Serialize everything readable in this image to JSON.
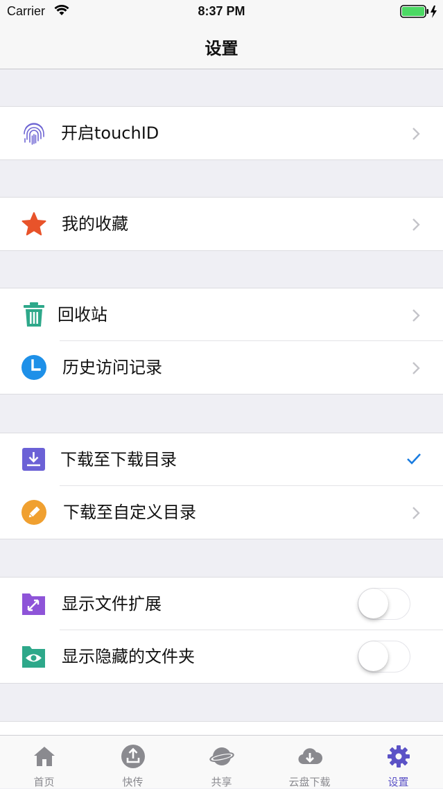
{
  "status_bar": {
    "carrier": "Carrier",
    "time": "8:37 PM",
    "battery_color": "#4cd964"
  },
  "nav": {
    "title": "设置"
  },
  "groups": [
    {
      "rows": [
        {
          "label": "开启touchID",
          "icon": "fingerprint-icon",
          "accessory": "chevron"
        }
      ]
    },
    {
      "rows": [
        {
          "label": "我的收藏",
          "icon": "star-icon",
          "accessory": "chevron"
        }
      ]
    },
    {
      "rows": [
        {
          "label": "回收站",
          "icon": "trash-icon",
          "accessory": "chevron"
        },
        {
          "label": "历史访问记录",
          "icon": "clock-icon",
          "accessory": "chevron"
        }
      ]
    },
    {
      "rows": [
        {
          "label": "下载至下载目录",
          "icon": "download-icon",
          "accessory": "checkmark",
          "selected": true
        },
        {
          "label": "下载至自定义目录",
          "icon": "pencil-icon",
          "accessory": "chevron"
        }
      ]
    },
    {
      "rows": [
        {
          "label": "显示文件扩展",
          "icon": "folder-expand-icon",
          "accessory": "toggle",
          "on": false
        },
        {
          "label": "显示隐藏的文件夹",
          "icon": "folder-eye-icon",
          "accessory": "toggle",
          "on": false
        }
      ]
    }
  ],
  "tabbar": {
    "active_color": "#5b52c6",
    "items": [
      {
        "label": "首页",
        "icon": "home-icon"
      },
      {
        "label": "快传",
        "icon": "upload-icon"
      },
      {
        "label": "共享",
        "icon": "planet-icon"
      },
      {
        "label": "云盘下载",
        "icon": "cloud-download-icon"
      },
      {
        "label": "设置",
        "icon": "settings-gear-icon",
        "active": true
      }
    ]
  }
}
